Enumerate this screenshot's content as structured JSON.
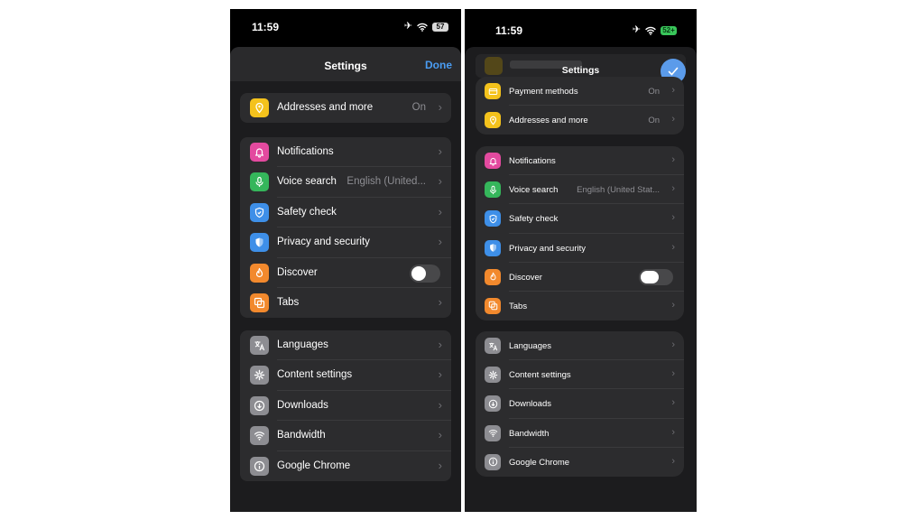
{
  "left": {
    "status": {
      "time": "11:59",
      "battery": "57"
    },
    "header": {
      "title": "Settings",
      "done_label": "Done"
    },
    "group1": [
      {
        "label": "Addresses and more",
        "value": "On",
        "icon": "location-pin-icon",
        "color": "#f4c21c"
      }
    ],
    "group2": [
      {
        "label": "Notifications",
        "value": "",
        "icon": "bell-icon",
        "color": "#e34a9f"
      },
      {
        "label": "Voice search",
        "value": "English (United...",
        "icon": "microphone-icon",
        "color": "#35b65b"
      },
      {
        "label": "Safety check",
        "value": "",
        "icon": "shield-check-icon",
        "color": "#3e8fe8"
      },
      {
        "label": "Privacy and security",
        "value": "",
        "icon": "shield-icon",
        "color": "#3e8fe8"
      },
      {
        "label": "Discover",
        "value": "",
        "icon": "flame-icon",
        "color": "#f2892d",
        "toggle": false
      },
      {
        "label": "Tabs",
        "value": "",
        "icon": "tabs-icon",
        "color": "#f2892d"
      }
    ],
    "group3": [
      {
        "label": "Languages",
        "value": "",
        "icon": "translate-icon",
        "color": "#8d8d92"
      },
      {
        "label": "Content settings",
        "value": "",
        "icon": "gear-icon",
        "color": "#8d8d92"
      },
      {
        "label": "Downloads",
        "value": "",
        "icon": "download-icon",
        "color": "#8d8d92"
      },
      {
        "label": "Bandwidth",
        "value": "",
        "icon": "wifi-icon",
        "color": "#8d8d92"
      },
      {
        "label": "Google Chrome",
        "value": "",
        "icon": "info-icon",
        "color": "#8d8d92"
      }
    ]
  },
  "right": {
    "status": {
      "time": "11:59",
      "battery": "52+"
    },
    "header": {
      "title": "Settings"
    },
    "group1": [
      {
        "label": "Payment methods",
        "value": "On",
        "icon": "credit-card-icon",
        "color": "#f4c21c"
      },
      {
        "label": "Addresses and more",
        "value": "On",
        "icon": "location-pin-icon",
        "color": "#f4c21c"
      }
    ],
    "group2": [
      {
        "label": "Notifications",
        "value": "",
        "icon": "bell-icon",
        "color": "#e34a9f"
      },
      {
        "label": "Voice search",
        "value": "English (United Stat...",
        "icon": "microphone-icon",
        "color": "#35b65b"
      },
      {
        "label": "Safety check",
        "value": "",
        "icon": "shield-check-icon",
        "color": "#3e8fe8"
      },
      {
        "label": "Privacy and security",
        "value": "",
        "icon": "shield-icon",
        "color": "#3e8fe8"
      },
      {
        "label": "Discover",
        "value": "",
        "icon": "flame-icon",
        "color": "#f2892d",
        "toggle": false
      },
      {
        "label": "Tabs",
        "value": "",
        "icon": "tabs-icon",
        "color": "#f2892d"
      }
    ],
    "group3": [
      {
        "label": "Languages",
        "value": "",
        "icon": "translate-icon",
        "color": "#8d8d92"
      },
      {
        "label": "Content settings",
        "value": "",
        "icon": "gear-icon",
        "color": "#8d8d92"
      },
      {
        "label": "Downloads",
        "value": "",
        "icon": "download-icon",
        "color": "#8d8d92"
      },
      {
        "label": "Bandwidth",
        "value": "",
        "icon": "wifi-icon",
        "color": "#8d8d92"
      },
      {
        "label": "Google Chrome",
        "value": "",
        "icon": "info-icon",
        "color": "#8d8d92"
      }
    ]
  }
}
